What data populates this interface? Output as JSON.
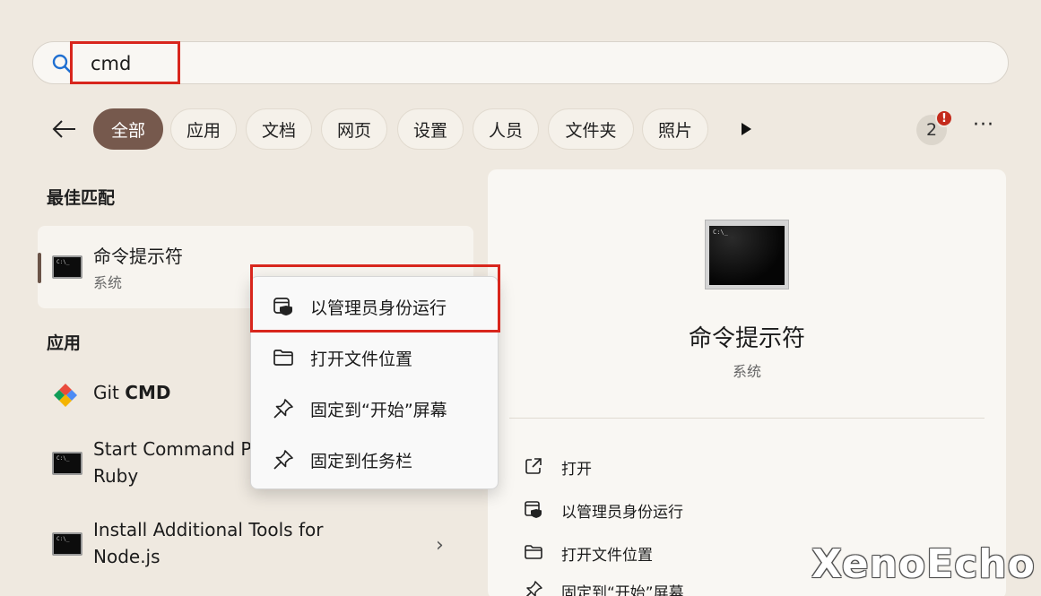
{
  "search": {
    "value": "cmd"
  },
  "filters": {
    "chips": [
      "全部",
      "应用",
      "文档",
      "网页",
      "设置",
      "人员",
      "文件夹",
      "照片"
    ],
    "active": "全部",
    "avatar_label": "2",
    "alert_label": "!",
    "more_label": "···"
  },
  "best_match": {
    "heading": "最佳匹配",
    "title": "命令提示符",
    "subtitle": "系统"
  },
  "apps": {
    "heading": "应用",
    "items": [
      {
        "title_prefix": "Git ",
        "title_bold": "CMD"
      },
      {
        "line1": "Start Command P",
        "line2": "Ruby"
      },
      {
        "line1": "Install Additional Tools for",
        "line2": "Node.js"
      }
    ],
    "chevron": "›"
  },
  "context_menu": {
    "items": [
      {
        "label": "以管理员身份运行",
        "icon": "shield-app-icon"
      },
      {
        "label": "打开文件位置",
        "icon": "folder-icon"
      },
      {
        "label": "固定到“开始”屏幕",
        "icon": "pin-icon"
      },
      {
        "label": "固定到任务栏",
        "icon": "pin-icon"
      }
    ]
  },
  "detail": {
    "title": "命令提示符",
    "subtitle": "系统",
    "actions": [
      {
        "label": "打开",
        "icon": "open-external-icon"
      },
      {
        "label": "以管理员身份运行",
        "icon": "shield-app-icon"
      },
      {
        "label": "打开文件位置",
        "icon": "folder-icon"
      },
      {
        "label": "固定到“开始”屏幕",
        "icon": "pin-icon"
      }
    ]
  },
  "watermark": "XenoEcho",
  "colors": {
    "background": "#efe9e0",
    "active_chip": "#76594d",
    "highlight": "#d8261d",
    "alert": "#c42b1c"
  }
}
